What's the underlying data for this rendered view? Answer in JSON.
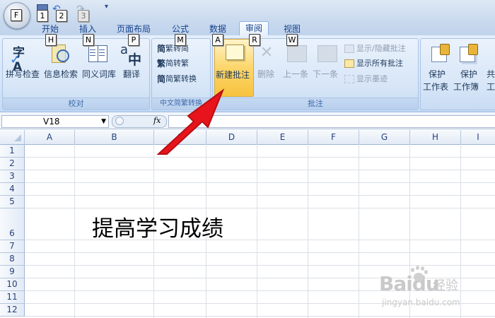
{
  "quick_access": {
    "keytips": [
      "F",
      "1",
      "2",
      "3"
    ]
  },
  "tabs": [
    {
      "label": "开始",
      "keytip": "H"
    },
    {
      "label": "插入",
      "keytip": "N"
    },
    {
      "label": "页面布局",
      "keytip": "P"
    },
    {
      "label": "公式",
      "keytip": "M"
    },
    {
      "label": "数据",
      "keytip": "A"
    },
    {
      "label": "审阅",
      "keytip": "R",
      "active": true
    },
    {
      "label": "视图",
      "keytip": "W"
    }
  ],
  "ribbon": {
    "proofing": {
      "label": "校对",
      "spell_check": "拼写检查",
      "research": "信息检索",
      "thesaurus": "同义词库",
      "translate": "翻译"
    },
    "chinese_conversion": {
      "label": "中文简繁转换",
      "to_simplified": "繁转简",
      "to_traditional": "简转繁",
      "convert": "简繁转换"
    },
    "comments": {
      "label": "批注",
      "new_comment": "新建批注",
      "delete": "删除",
      "previous": "上一条",
      "next": "下一条",
      "show_hide": "显示/隐藏批注",
      "show_all": "显示所有批注",
      "show_ink": "显示墨迹"
    },
    "changes": {
      "protect_sheet": "保护",
      "protect_sheet_2": "工作表",
      "protect_workbook": "保护",
      "protect_workbook_2": "工作簿",
      "more": "共",
      "more_2": "工"
    }
  },
  "formula_bar": {
    "name_box": "V18",
    "fx": "fx",
    "value": ""
  },
  "sheet": {
    "columns": [
      "A",
      "B",
      "C",
      "D",
      "E",
      "F",
      "G",
      "H",
      "I"
    ],
    "rows": [
      "1",
      "2",
      "3",
      "4",
      "5",
      "6",
      "7",
      "8",
      "9",
      "10",
      "11",
      "12"
    ],
    "cell_b6": "提高学习成绩"
  },
  "watermark": {
    "brand": "Baidu",
    "brand_cn": "经验",
    "url": "jingyan.baidu.com"
  },
  "colors": {
    "accent": "#15428b",
    "arrow": "#e8141b",
    "highlight": "#fcd66a"
  }
}
